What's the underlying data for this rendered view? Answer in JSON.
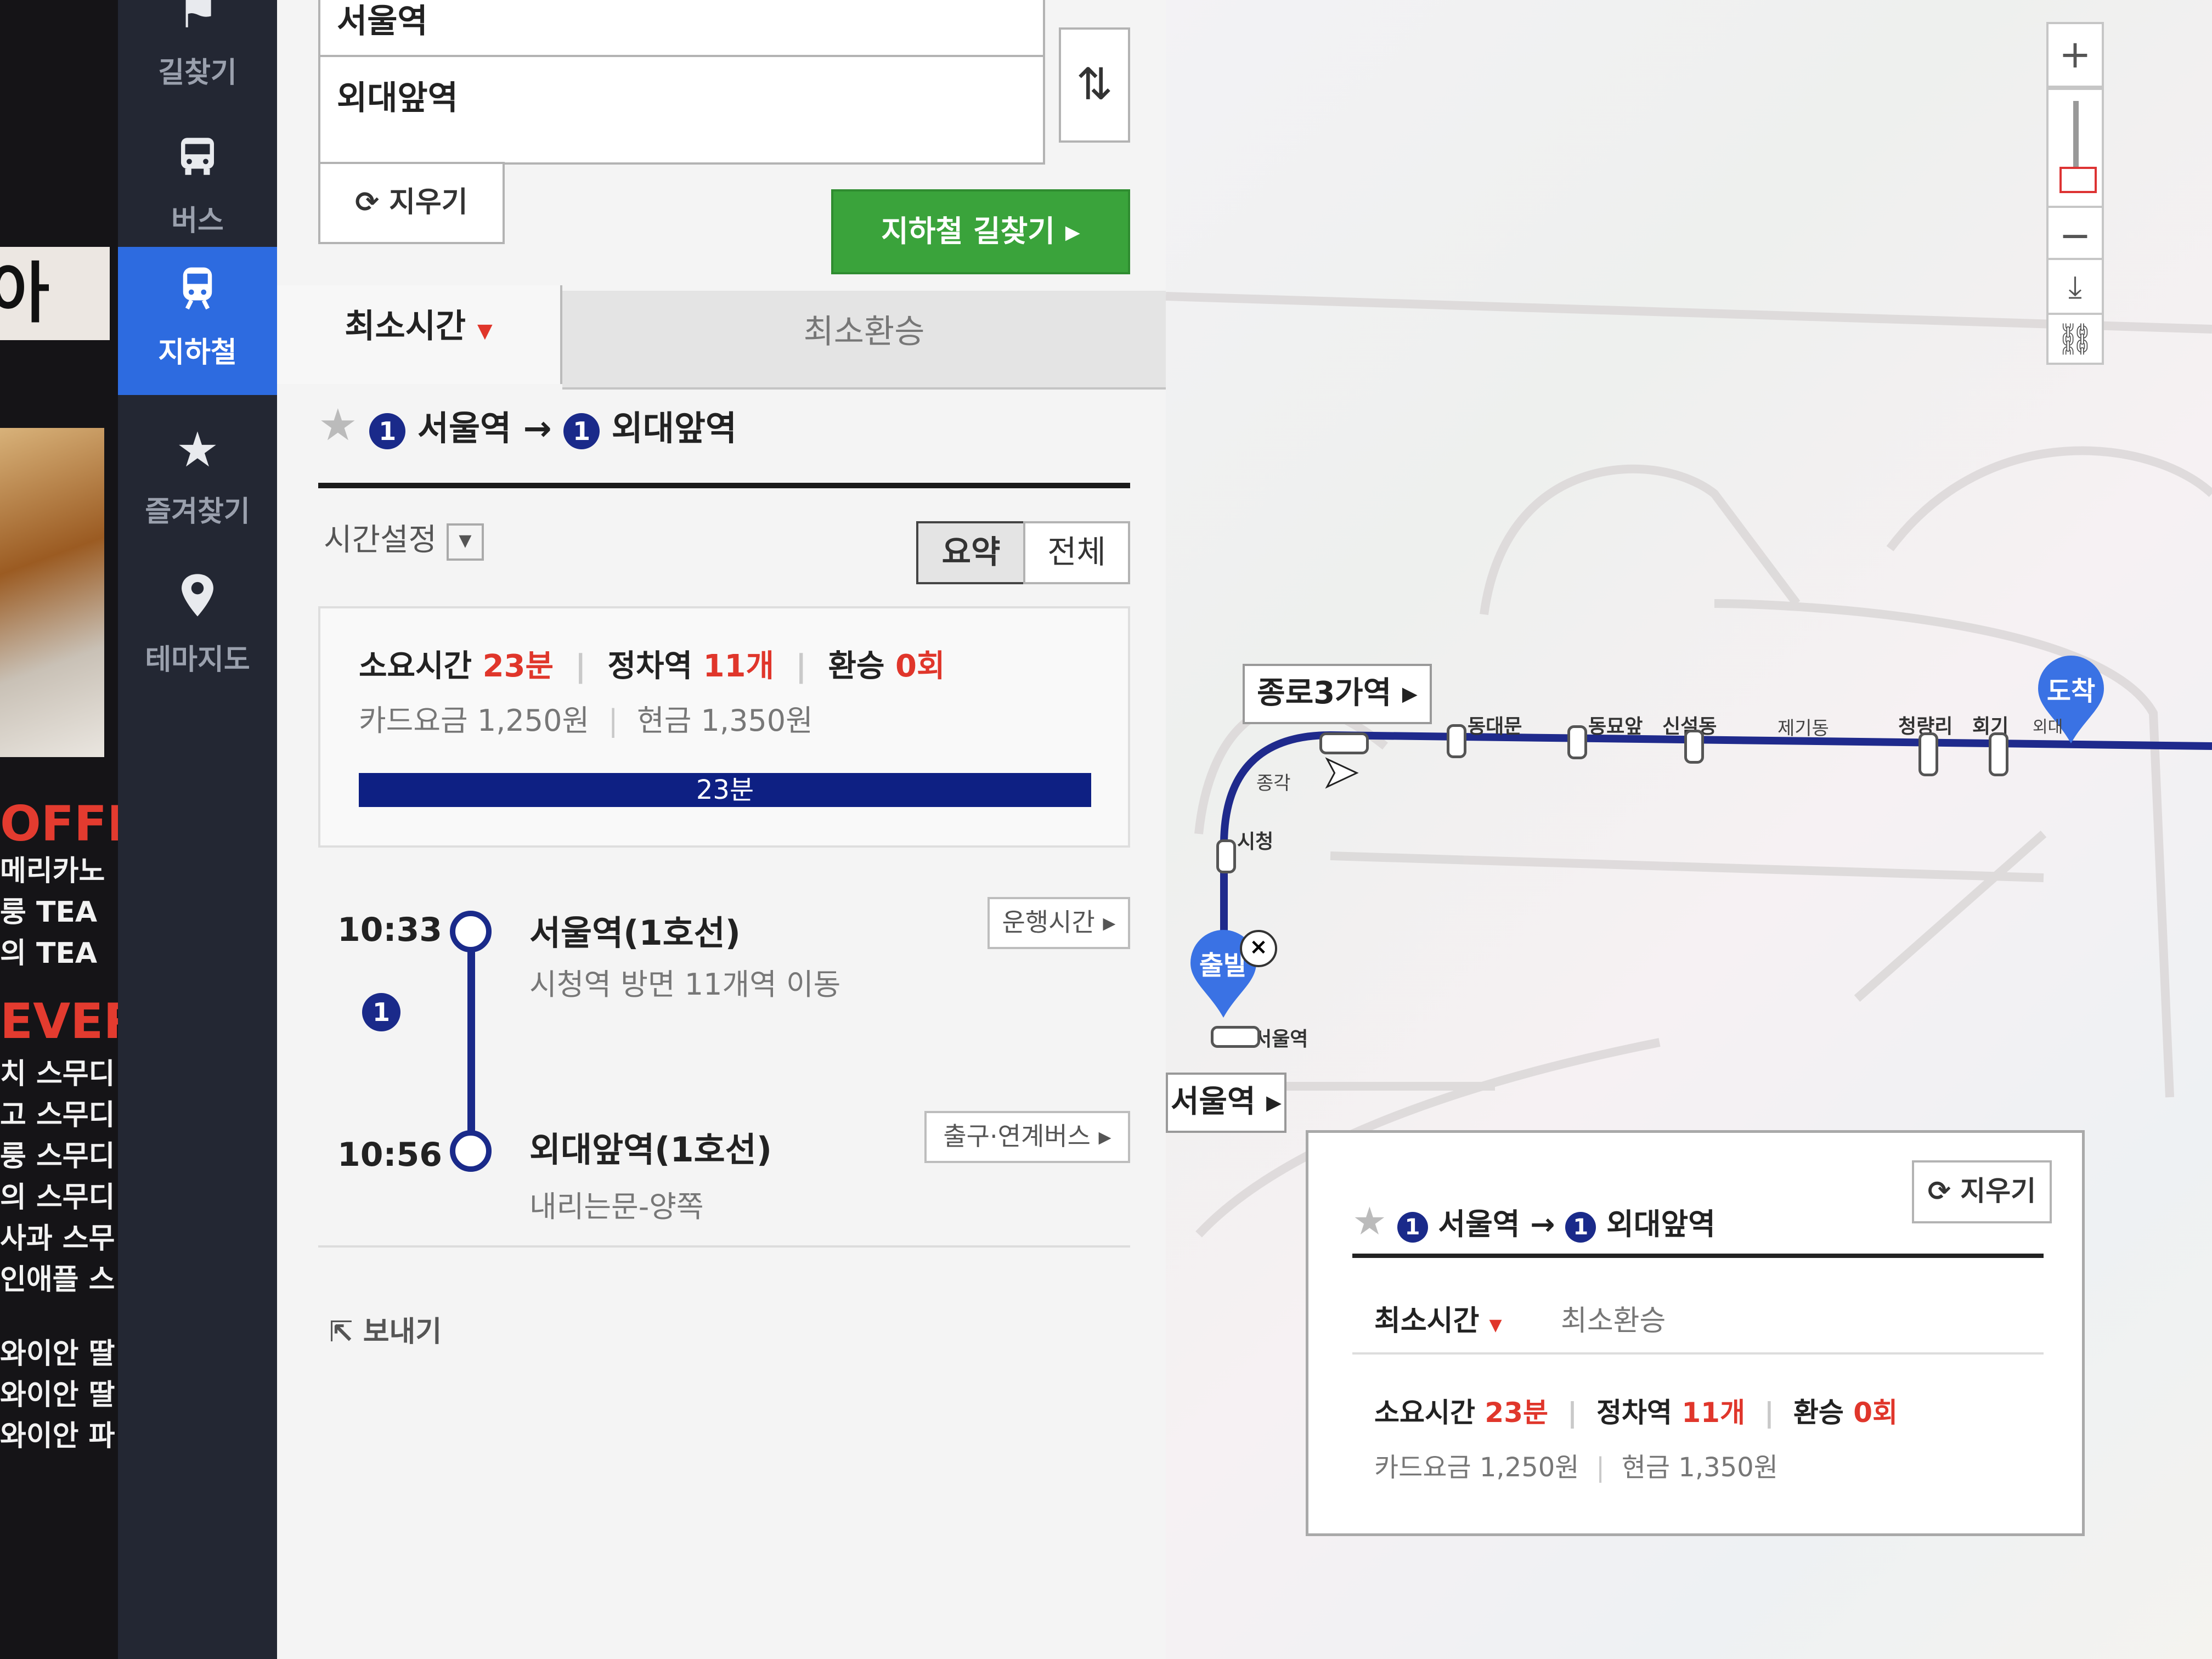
{
  "nav": {
    "items": [
      {
        "label": "길찾기",
        "icon": "flag-icon"
      },
      {
        "label": "버스",
        "icon": "bus-icon"
      },
      {
        "label": "지하철",
        "icon": "subway-icon"
      },
      {
        "label": "즐겨찾기",
        "icon": "star-icon"
      },
      {
        "label": "테마지도",
        "icon": "pin-icon"
      }
    ],
    "active_index": 2
  },
  "background_strip": {
    "logo": "아이",
    "heading1": "OFFE",
    "items1": [
      "메리카노",
      "룽 TEA",
      "의 TEA"
    ],
    "heading2": "EVER",
    "items2": [
      "치 스무디",
      "고 스무디",
      "룽 스무디",
      "의 스무디",
      "사과 스무",
      "인애플 스"
    ],
    "items3": [
      "와이안 딸",
      "와이안 딸",
      "와이안 파"
    ]
  },
  "search": {
    "from_value": "서울역",
    "to_value": "외대앞역",
    "clear_label": "지우기",
    "submit_label": "지하철 길찾기"
  },
  "tabs": {
    "active": "최소시간",
    "inactive": "최소환승"
  },
  "route": {
    "line": "1",
    "from": "서울역",
    "to": "외대앞역",
    "time_setting": "시간설정",
    "view_summary": "요약",
    "view_all": "전체"
  },
  "summary": {
    "duration_label": "소요시간",
    "duration_value": "23분",
    "stops_label": "정차역",
    "stops_value": "11개",
    "transfer_label": "환승",
    "transfer_value": "0회",
    "card_fare": "카드요금 1,250원",
    "cash_fare": "현금 1,350원",
    "bar_label": "23분"
  },
  "timeline": {
    "start_time": "10:33",
    "start_station": "서울역(1호선)",
    "start_desc": "시청역 방면 11개역 이동",
    "start_button": "운행시간",
    "line_badge": "1",
    "end_time": "10:56",
    "end_station": "외대앞역(1호선)",
    "end_desc": "내리는문-양쪽",
    "end_button": "출구·연계버스"
  },
  "send_label": "보내기",
  "map": {
    "callout_top": "종로3가역",
    "callout_bottom": "서울역",
    "start_marker": "출발",
    "end_marker": "도착",
    "stations": [
      "종각",
      "시청",
      "서울역",
      "동대문",
      "동묘앞",
      "신설동",
      "제기동",
      "청량리",
      "회기",
      "외대"
    ],
    "line_color": "#1f2a8c",
    "card": {
      "from": "서울역",
      "to": "외대앞역",
      "clear_label": "지우기",
      "tab_active": "최소시간",
      "tab_inactive": "최소환승",
      "duration_label": "소요시간",
      "duration_value": "23분",
      "stops_label": "정차역",
      "stops_value": "11개",
      "transfer_label": "환승",
      "transfer_value": "0회",
      "card_fare": "카드요금 1,250원",
      "cash_fare": "현금 1,350원"
    }
  },
  "colors": {
    "nav_bg": "#232733",
    "nav_active": "#2d6be0",
    "accent_green": "#3aa33b",
    "accent_red": "#e0362b",
    "line1_blue": "#1a2a8a"
  }
}
